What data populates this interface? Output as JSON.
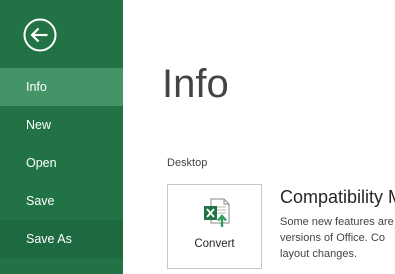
{
  "sidebar": {
    "back_icon": "back-arrow-icon",
    "background": "#217346",
    "selected_background": "#439467",
    "items": [
      {
        "label": "Info",
        "state": "selected"
      },
      {
        "label": "New",
        "state": "normal"
      },
      {
        "label": "Open",
        "state": "normal"
      },
      {
        "label": "Save",
        "state": "normal"
      },
      {
        "label": "Save As",
        "state": "hover"
      }
    ]
  },
  "main": {
    "title": "Info",
    "section_label": "Desktop",
    "convert": {
      "label": "Convert",
      "icon": "excel-convert-icon"
    },
    "compatibility": {
      "heading": "Compatibility M",
      "lines": [
        "Some new features are",
        "versions of Office. Co",
        "layout changes."
      ]
    }
  }
}
